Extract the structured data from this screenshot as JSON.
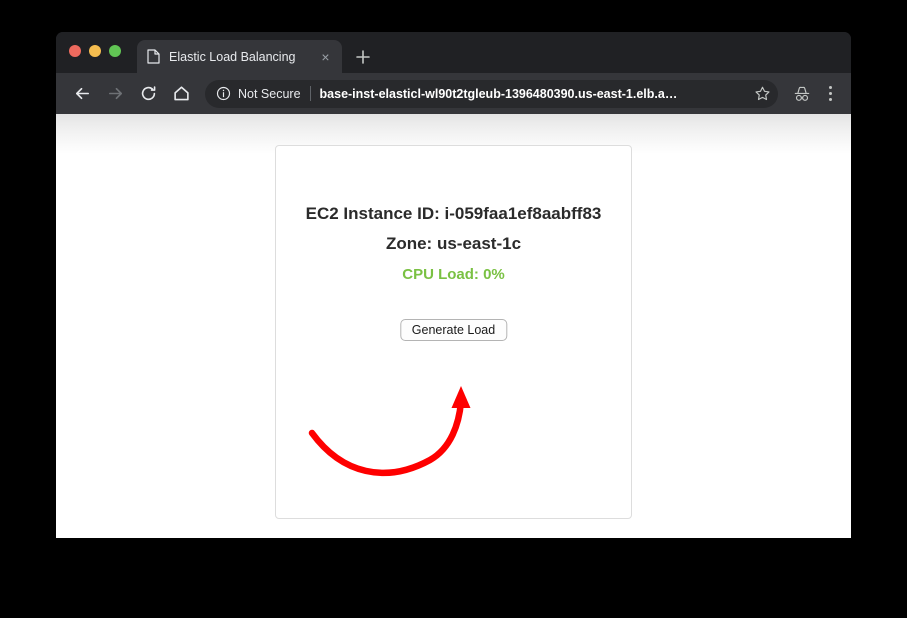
{
  "window": {
    "traffic_lights": [
      {
        "name": "close",
        "color": "#ed6a5e"
      },
      {
        "name": "minimize",
        "color": "#f5bd4f"
      },
      {
        "name": "zoom",
        "color": "#61c554"
      }
    ]
  },
  "tab_strip": {
    "tab": {
      "title": "Elastic Load Balancing",
      "favicon": "document-icon",
      "close_label": "×"
    },
    "new_tab_label": "+"
  },
  "toolbar": {
    "back_icon": "back-arrow-icon",
    "forward_icon": "forward-arrow-icon",
    "reload_icon": "reload-icon",
    "home_icon": "home-icon",
    "security_icon": "info-circle-icon",
    "security_text": "Not Secure",
    "url": "base-inst-elasticl-wl90t2tgleub-1396480390.us-east-1.elb.a…",
    "bookmark_icon": "star-icon",
    "incognito_icon": "incognito-icon",
    "menu_icon": "three-dot-menu-icon"
  },
  "page": {
    "card": {
      "instance_line": "EC2 Instance ID: i-059faa1ef8aabff83",
      "zone_line": "Zone: us-east-1c",
      "cpu_line": "CPU Load: 0%",
      "cpu_color": "#7ac143",
      "button_label": "Generate Load"
    },
    "annotation": {
      "type": "curved-arrow",
      "color": "#fe0000",
      "points_to": "Generate Load"
    }
  }
}
